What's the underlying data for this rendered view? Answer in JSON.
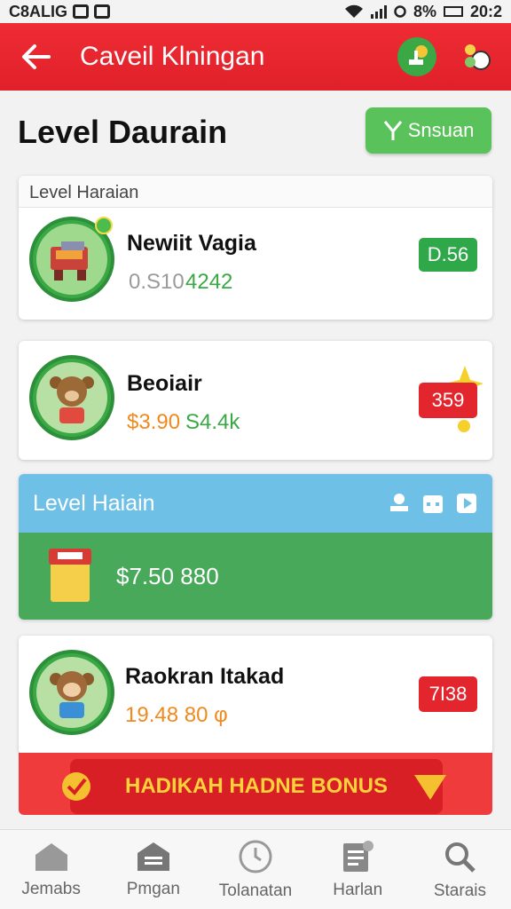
{
  "status_bar": {
    "carrier": "C8ALIG",
    "battery": "8%",
    "time": "20:2"
  },
  "app_bar": {
    "title": "Caveil Klningan"
  },
  "page": {
    "heading": "Level Daurain",
    "action_button": "Snsuan"
  },
  "cards": [
    {
      "caption": "Level Haraian",
      "name": "Newiit Vagia",
      "amount_grey": "0.S10",
      "amount_colored": "4242",
      "badge": "D.56",
      "badge_color": "#2fa84a"
    },
    {
      "name": "Beoiair",
      "amount_grey": "$3.90",
      "amount_colored": "S4.4k",
      "badge": "359",
      "badge_color": "#e3262d"
    },
    {
      "name": "Raokran Itakad",
      "amount": "19.48 80 φ",
      "badge": "7I38",
      "badge_color": "#e3262d"
    }
  ],
  "band": {
    "title": "Level Haiain",
    "amount": "$7.50 880"
  },
  "bonus": {
    "label": "HADIKAH HADNE BONUS"
  },
  "nav": [
    {
      "label": "Jemabs",
      "icon": "home-icon"
    },
    {
      "label": "Pmgan",
      "icon": "house-list-icon"
    },
    {
      "label": "Tolanatan",
      "icon": "clock-icon"
    },
    {
      "label": "Harlan",
      "icon": "document-icon"
    },
    {
      "label": "Starais",
      "icon": "search-icon"
    }
  ],
  "colors": {
    "primary_red": "#e3262d",
    "green": "#48a95b",
    "blue": "#6fc0e6"
  }
}
